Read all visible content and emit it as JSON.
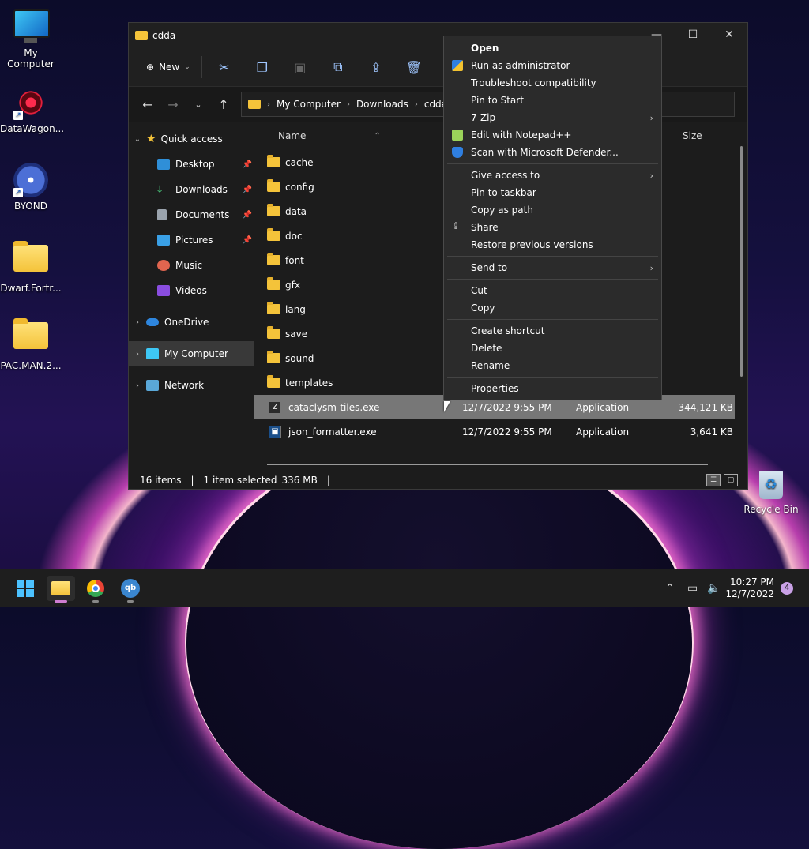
{
  "desktop": {
    "icons": [
      {
        "label": "My Computer"
      },
      {
        "label": "DataWagon..."
      },
      {
        "label": "BYOND"
      },
      {
        "label": "Dwarf.Fortr..."
      },
      {
        "label": "PAC.MAN.2..."
      }
    ],
    "recycle_bin": "Recycle Bin"
  },
  "window": {
    "title": "cdda",
    "toolbar": {
      "new_label": "New"
    },
    "breadcrumb": [
      "My Computer",
      "Downloads",
      "cdda"
    ]
  },
  "navpane": {
    "items": [
      {
        "label": "Quick access"
      },
      {
        "label": "Desktop"
      },
      {
        "label": "Downloads"
      },
      {
        "label": "Documents"
      },
      {
        "label": "Pictures"
      },
      {
        "label": "Music"
      },
      {
        "label": "Videos"
      },
      {
        "label": "OneDrive"
      },
      {
        "label": "My Computer"
      },
      {
        "label": "Network"
      }
    ]
  },
  "files": {
    "columns": {
      "name": "Name",
      "size": "Size"
    },
    "folders": [
      "cache",
      "config",
      "data",
      "doc",
      "font",
      "gfx",
      "lang",
      "save",
      "sound",
      "templates"
    ],
    "exe_rows": [
      {
        "name": "cataclysm-tiles.exe",
        "date": "12/7/2022 9:55 PM",
        "type": "Application",
        "size": "344,121 KB"
      },
      {
        "name": "json_formatter.exe",
        "date": "12/7/2022 9:55 PM",
        "type": "Application",
        "size": "3,641 KB"
      }
    ]
  },
  "status": {
    "items": "16 items",
    "selected": "1 item selected",
    "size": "336 MB"
  },
  "context_menu": {
    "items": [
      "Open",
      "Run as administrator",
      "Troubleshoot compatibility",
      "Pin to Start",
      "7-Zip",
      "Edit with Notepad++",
      "Scan with Microsoft Defender...",
      "Give access to",
      "Pin to taskbar",
      "Copy as path",
      "Share",
      "Restore previous versions",
      "Send to",
      "Cut",
      "Copy",
      "Create shortcut",
      "Delete",
      "Rename",
      "Properties"
    ]
  },
  "taskbar": {
    "time": "10:27 PM",
    "date": "12/7/2022",
    "notifications": "4",
    "qb_label": "qb"
  },
  "colors": {
    "accent": "#4cc2ff",
    "folder": "#f4c33a",
    "selection": "#777777"
  }
}
